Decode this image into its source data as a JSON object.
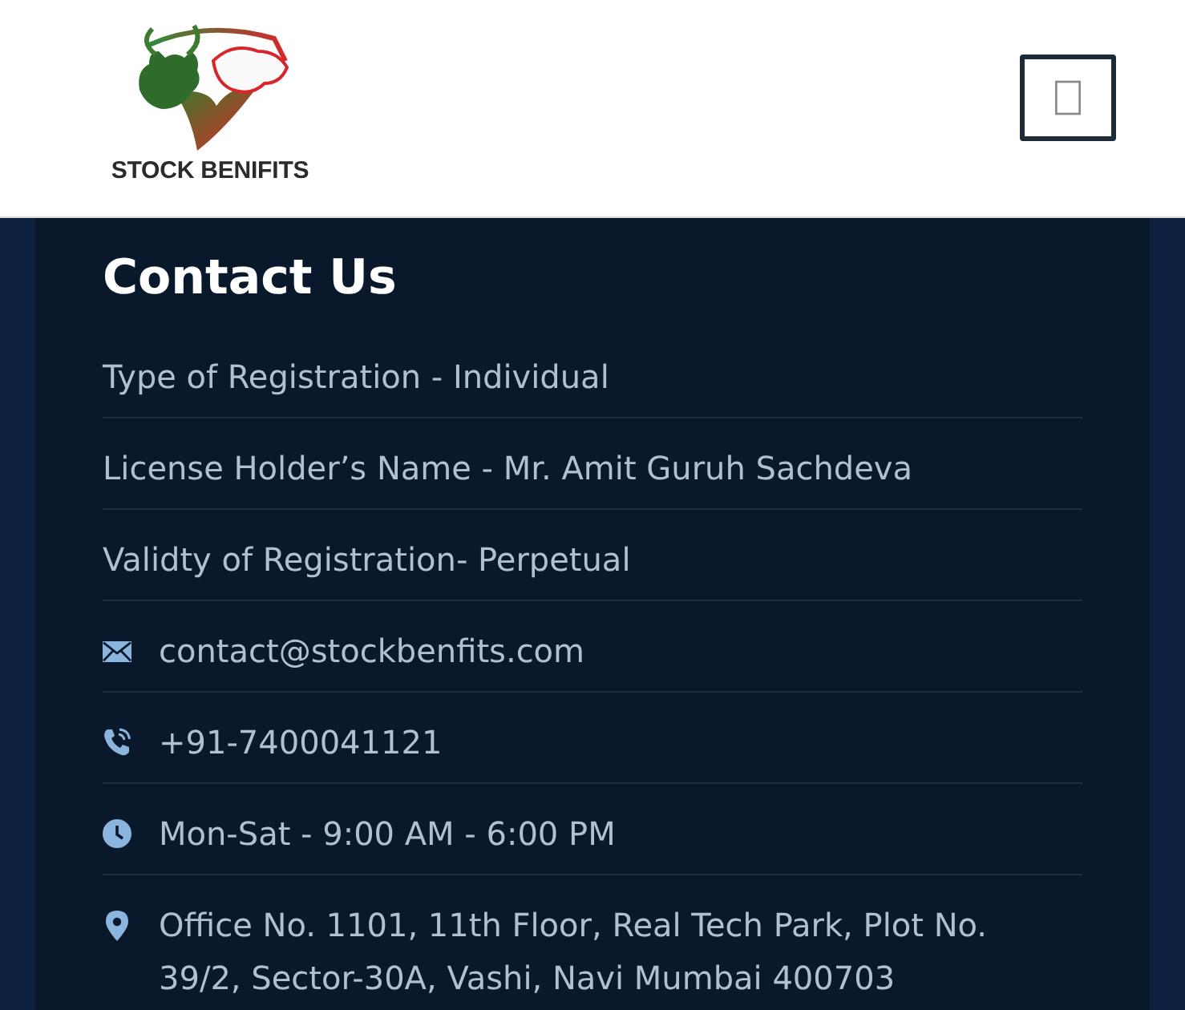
{
  "header": {
    "logo": {
      "text": "STOCK BENIFITS"
    }
  },
  "contact": {
    "title": "Contact Us",
    "items": [
      {
        "kind": "plain",
        "text": "Type of Registration - Individual"
      },
      {
        "kind": "plain",
        "text": "License Holder’s Name - Mr. Amit Guruh Sachdeva"
      },
      {
        "kind": "plain",
        "text": "Validty of Registration- Perpetual"
      },
      {
        "kind": "email",
        "text": "contact@stockbenfits.com"
      },
      {
        "kind": "phone",
        "text": "+91-7400041121"
      },
      {
        "kind": "hours",
        "text": "Mon-Sat - 9:00 AM - 6:00 PM"
      },
      {
        "kind": "address",
        "text": "Office No. 1101, 11th Floor, Real Tech Park, Plot No. 39/2, Sector-30A, Vashi, Navi Mumbai 400703"
      }
    ]
  }
}
